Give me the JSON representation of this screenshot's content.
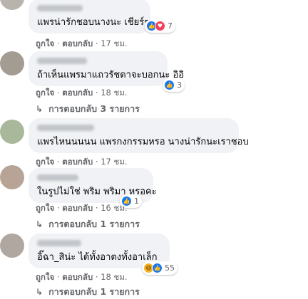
{
  "comments": [
    {
      "text": "แพรน่ารักชอบนางนะ เชียร์ๆ",
      "like_label": "ถูกใจ",
      "reply_label": "ตอบกลับ",
      "time": "17 ชม.",
      "reaction_count": "7",
      "reactions": [
        "like",
        "love"
      ]
    },
    {
      "text": "ถ้าเห็นแพรมาแถวรัชดาจะบอกนะ อิอิ",
      "like_label": "ถูกใจ",
      "reply_label": "ตอบกลับ",
      "time": "18 ชม.",
      "reaction_count": "3",
      "reactions": [
        "like"
      ],
      "replies_label": "การตอบกลับ 3 รายการ"
    },
    {
      "text": "แพรไหนนนนน แพรกงกรรมหรอ นางน่ารักนะเราชอบ",
      "like_label": "ถูกใจ",
      "reply_label": "ตอบกลับ",
      "time": "17 ชม."
    },
    {
      "text": "ในรูปไม่ใช่ พริม พริมา หรอคะ",
      "like_label": "ถูกใจ",
      "reply_label": "ตอบกลับ",
      "time": "16 ชม.",
      "reaction_count": "1",
      "reactions": [
        "like"
      ],
      "replies_label": "การตอบกลับ 1 รายการ"
    },
    {
      "text": "อิ๊ฉา_สิน่ะ ได้ทั้งอาตงทั้งอาเล็ก",
      "like_label": "ถูกใจ",
      "reply_label": "ตอบกลับ",
      "time": "18 ชม.",
      "reaction_count": "55",
      "reactions": [
        "haha",
        "like"
      ],
      "replies_label": "การตอบกลับ 1 รายการ"
    }
  ],
  "colors": {
    "bubble": "#f0f2f5",
    "meta": "#65676b",
    "like": "#1877f2",
    "love": "#f33e58",
    "haha": "#f7b125"
  },
  "icons": {
    "reply_arrow": "reply-arrow-icon",
    "like": "like-reaction-icon",
    "love": "love-reaction-icon",
    "haha": "haha-reaction-icon"
  }
}
